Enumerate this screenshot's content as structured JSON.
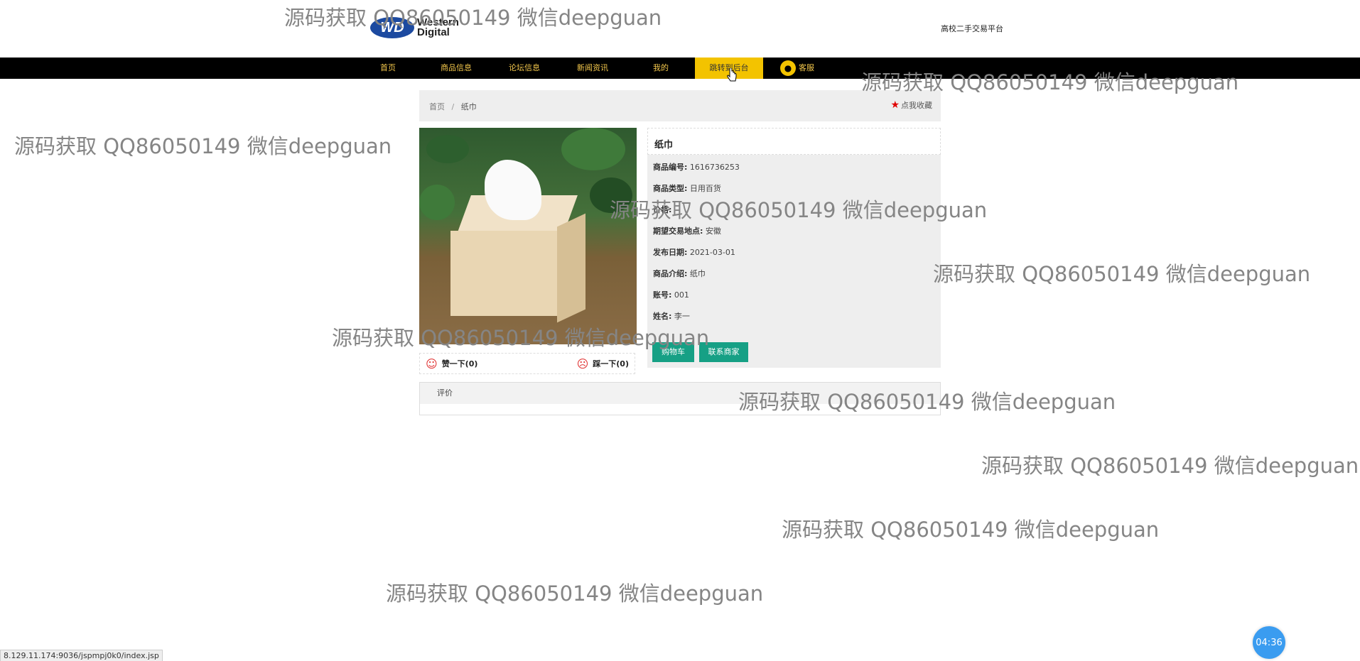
{
  "header": {
    "logo_line1": "Western",
    "logo_line2": "Digital",
    "logo_badge": "WD",
    "site_title": "高校二手交易平台"
  },
  "nav": {
    "items": [
      {
        "label": "首页"
      },
      {
        "label": "商品信息"
      },
      {
        "label": "论坛信息"
      },
      {
        "label": "新闻资讯"
      },
      {
        "label": "我的"
      },
      {
        "label": "跳转到后台"
      },
      {
        "label": "客服"
      }
    ],
    "active_index": 5
  },
  "breadcrumb": {
    "home": "首页",
    "separator": "/",
    "current": "纸巾"
  },
  "favorite": {
    "label": "点我收藏",
    "star": "★"
  },
  "vote": {
    "like_label": "赞一下(0)",
    "dislike_label": "踩一下(0)"
  },
  "product": {
    "title": "纸巾",
    "fields": [
      {
        "label": "商品编号:",
        "value": "1616736253"
      },
      {
        "label": "商品类型:",
        "value": "日用百货"
      },
      {
        "label": "价格:",
        "value": ""
      },
      {
        "label": "期望交易地点:",
        "value": "安徽"
      },
      {
        "label": "发布日期:",
        "value": "2021-03-01"
      },
      {
        "label": "商品介绍:",
        "value": "纸巾"
      },
      {
        "label": "账号:",
        "value": "001"
      },
      {
        "label": "姓名:",
        "value": "李一"
      }
    ]
  },
  "actions": {
    "cart_label": "购物车",
    "contact_label": "联系商家"
  },
  "reviews": {
    "heading": "评价"
  },
  "watermark_text": "源码获取 QQ86050149 微信deepguan",
  "status_url": "8.129.11.174:9036/jspmpj0k0/index.jsp",
  "timer": "04:36",
  "colors": {
    "nav_bg": "#000000",
    "nav_text": "#f3c74c",
    "nav_active": "#f3c300",
    "button": "#16a085",
    "star": "#e00000"
  }
}
